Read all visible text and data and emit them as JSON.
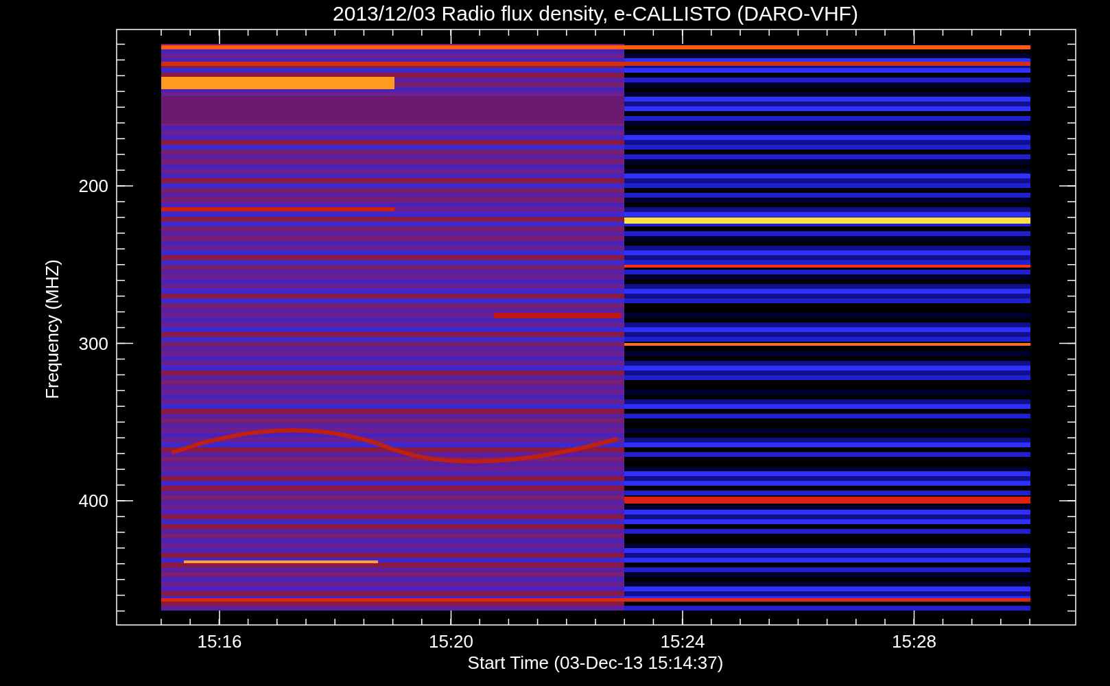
{
  "title": "2013/12/03  Radio flux density, e-CALLISTO (DARO-VHF)",
  "plot": {
    "ylabel": "Frequency (MHZ)",
    "xlabel": "Start Time (03-Dec-13 15:14:37)",
    "yticks": [
      "200",
      "300",
      "400"
    ],
    "xticks": [
      "15:16",
      "15:20",
      "15:24",
      "15:28"
    ]
  }
}
